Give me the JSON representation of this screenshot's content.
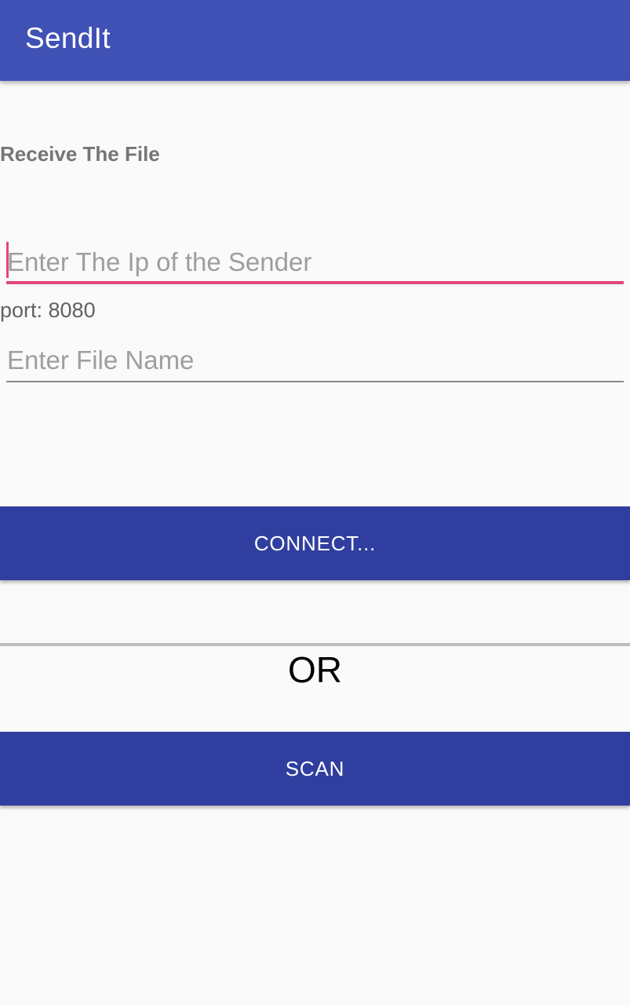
{
  "app_bar": {
    "title": "SendIt",
    "color": "#3F51B5"
  },
  "receive_section": {
    "heading": "Receive The File",
    "ip_field": {
      "value": "",
      "placeholder": "Enter The Ip of the Sender",
      "focused": true,
      "accent_color": "#E2457F"
    },
    "port_label": "port: 8080",
    "file_name_field": {
      "value": "",
      "placeholder": "Enter File Name"
    }
  },
  "actions": {
    "connect_label": "CONNECT...",
    "or_label": "OR",
    "scan_label": "SCAN",
    "button_color": "#303F9F"
  }
}
